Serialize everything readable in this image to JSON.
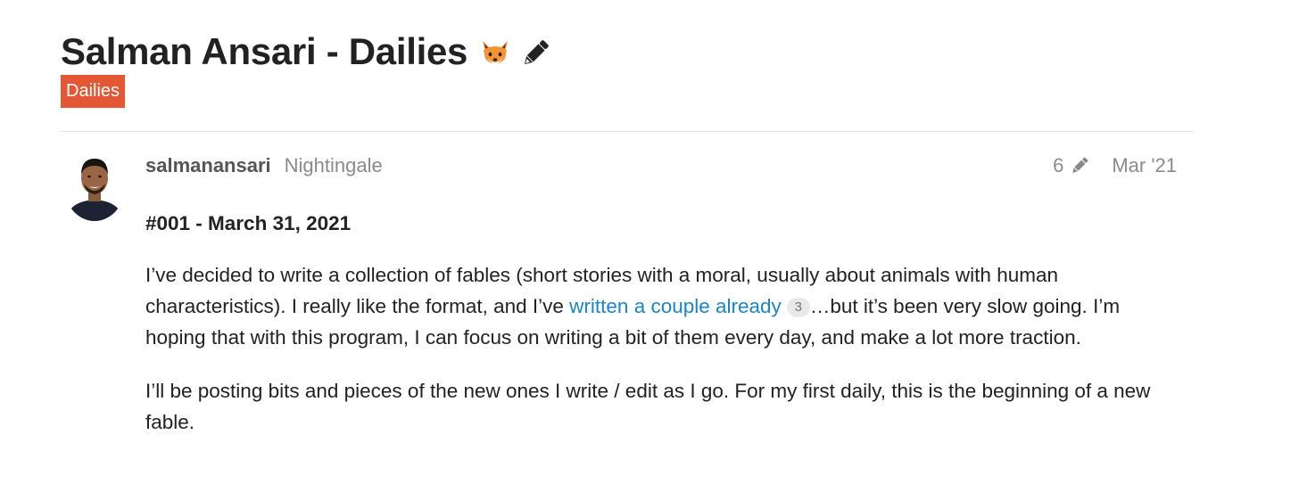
{
  "topic": {
    "title": "Salman Ansari - Dailies",
    "title_icons": [
      "fox-icon",
      "pencil-icon"
    ],
    "category": "Dailies",
    "category_color": "#e45735"
  },
  "post": {
    "username": "salmanansari",
    "user_title": "Nightingale",
    "edit_count": "6",
    "date": "Mar '21",
    "heading": "#001 - March 31, 2021",
    "para1_before_link": "I’ve decided to write a collection of fables (short stories with a moral, usually about animals with human characteristics). I really like the format, and I’ve ",
    "para1_link": "written a couple already",
    "para1_link_clicks": "3",
    "para1_after_link": "…but it’s been very slow going. I’m hoping that with this program, I can focus on writing a bit of them every day, and make a lot more traction.",
    "para2": "I’ll be posting bits and pieces of the new ones I write / edit as I go. For my first daily, this is the beginning of a new fable.",
    "link_color": "#1a85c7"
  }
}
